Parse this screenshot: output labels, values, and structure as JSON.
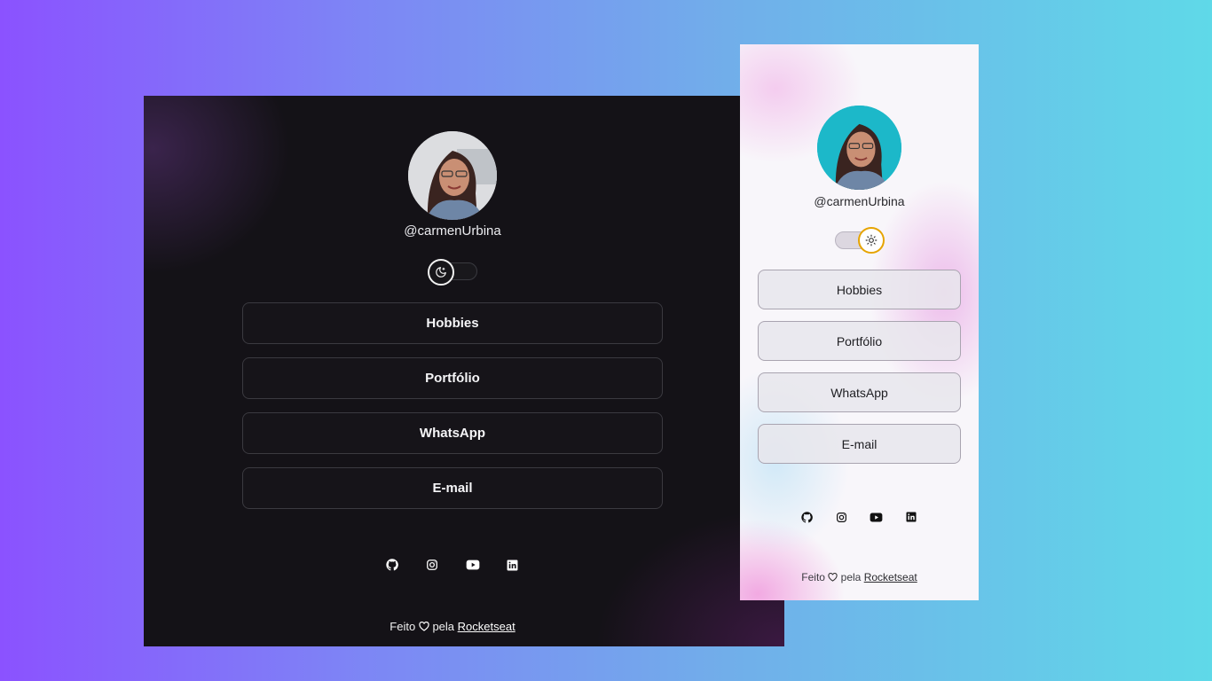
{
  "colors": {
    "background_gradient": [
      "#8b52ff",
      "#7d86f5",
      "#71aeea",
      "#5fd9e8"
    ],
    "dark_bg": "#141217",
    "light_bg": "#f8f6fa",
    "sun_accent": "#e6a400",
    "light_avatar_bg": "#1cb8c9"
  },
  "dark": {
    "theme": "dark",
    "username": "@carmenUrbina",
    "toggle_icon": "moon-icon",
    "links": [
      {
        "label": "Hobbies"
      },
      {
        "label": "Portfólio"
      },
      {
        "label": "WhatsApp"
      },
      {
        "label": "E-mail"
      }
    ],
    "socials": [
      "github-icon",
      "instagram-icon",
      "youtube-icon",
      "linkedin-icon"
    ],
    "footer": {
      "prefix": "Feito",
      "middle": "pela",
      "link": "Rocketseat"
    }
  },
  "light": {
    "theme": "light",
    "username": "@carmenUrbina",
    "toggle_icon": "sun-icon",
    "links": [
      {
        "label": "Hobbies"
      },
      {
        "label": "Portfólio"
      },
      {
        "label": "WhatsApp"
      },
      {
        "label": "E-mail"
      }
    ],
    "socials": [
      "github-icon",
      "instagram-icon",
      "youtube-icon",
      "linkedin-icon"
    ],
    "footer": {
      "prefix": "Feito",
      "middle": "pela",
      "link": "Rocketseat"
    }
  }
}
